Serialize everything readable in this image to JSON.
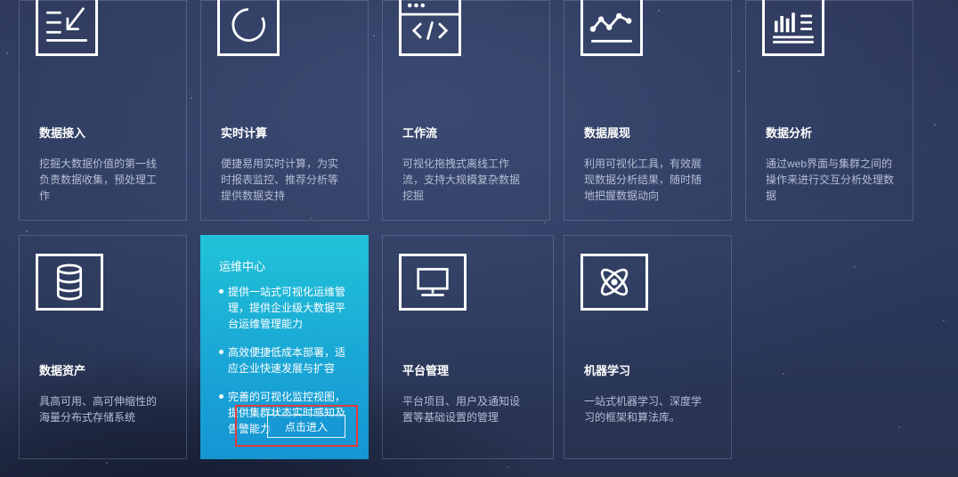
{
  "cards": [
    {
      "title": "数据接入",
      "desc": "挖掘大数据价值的第一线负责数据收集，预处理工作",
      "icon": "data-import-icon"
    },
    {
      "title": "实时计算",
      "desc": "便捷易用实时计算，为实时报表监控、推荐分析等提供数据支持",
      "icon": "circle-progress-icon"
    },
    {
      "title": "工作流",
      "desc": "可视化拖拽式离线工作流，支持大规模复杂数据挖掘",
      "icon": "code-window-icon"
    },
    {
      "title": "数据展现",
      "desc": "利用可视化工具，有效展现数据分析结果，随时随地把握数据动向",
      "icon": "line-chart-icon"
    },
    {
      "title": "数据分析",
      "desc": "通过web界面与集群之间的操作来进行交互分析处理数据",
      "icon": "bar-chart-icon"
    },
    {
      "title": "数据资产",
      "desc": "具高可用、高可伸缩性的海量分布式存储系统",
      "icon": "database-icon"
    },
    {
      "title": "平台管理",
      "desc": "平台项目、用户及通知设置等基础设置的管理",
      "icon": "monitor-icon"
    },
    {
      "title": "机器学习",
      "desc": "一站式机器学习、深度学习的框架和算法库。",
      "icon": "atom-icon"
    }
  ],
  "featured": {
    "title": "运维中心",
    "items": [
      "提供一站式可视化运维管理，提供企业级大数据平台运维管理能力",
      "高效便捷低成本部署，适应企业快速发展与扩容",
      "完善的可视化监控视图，提供集群状态实时感知及告警能力"
    ],
    "button": "点击进入"
  },
  "colors": {
    "featured_top": "#21c3d8",
    "featured_bottom": "#1595d3",
    "highlight": "#e43a3a"
  }
}
